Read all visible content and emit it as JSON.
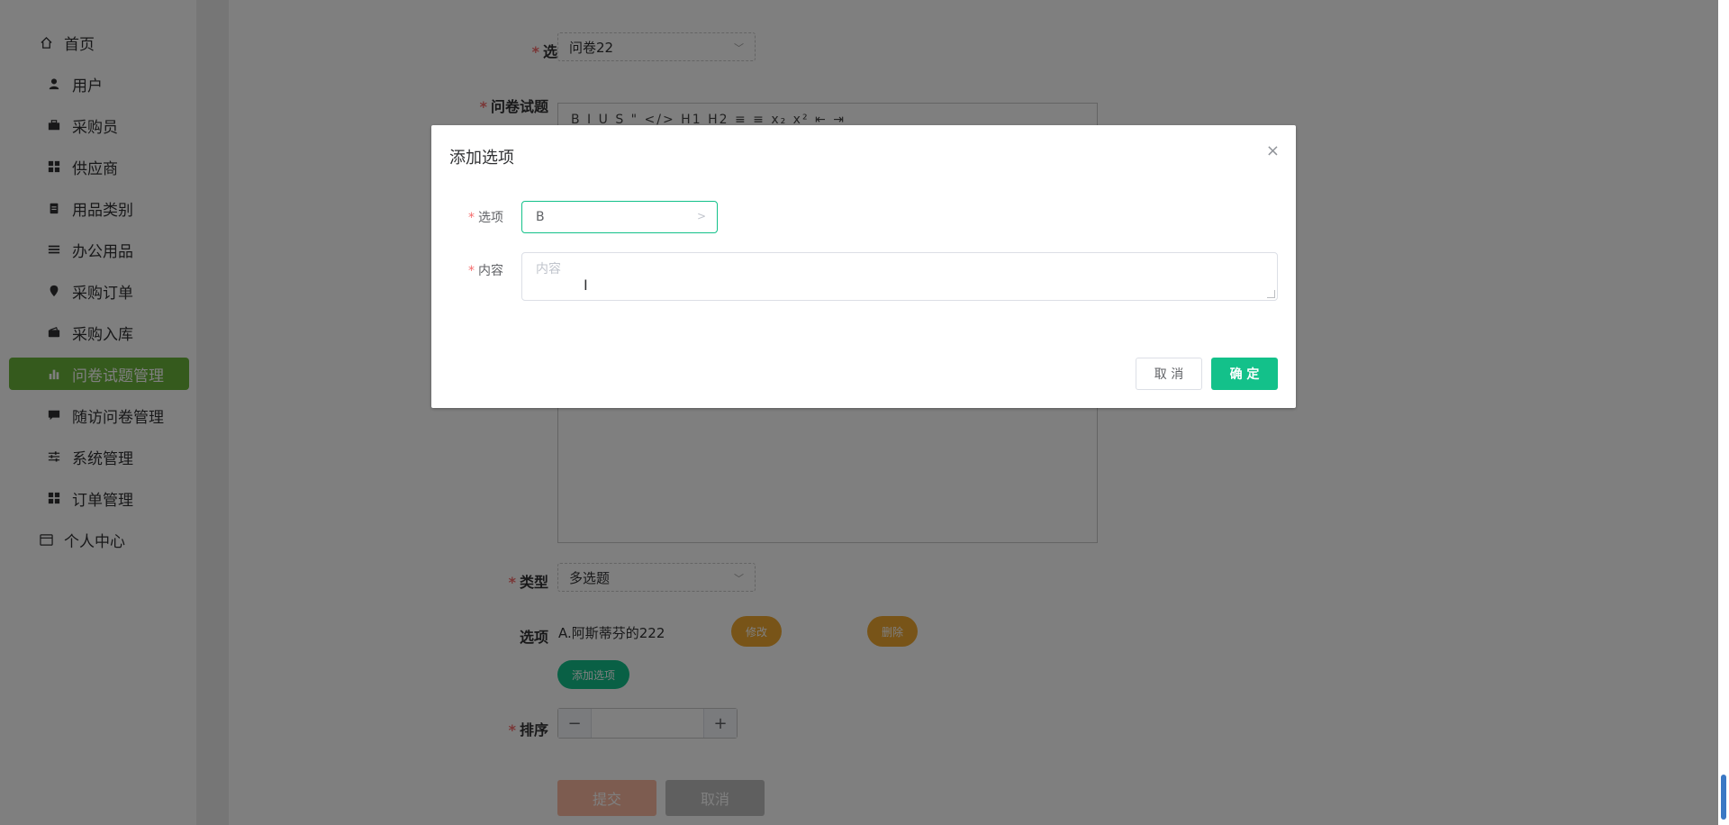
{
  "sidebar": {
    "items": [
      {
        "label": "首页",
        "icon": "home-icon"
      },
      {
        "label": "用户",
        "icon": "user-icon"
      },
      {
        "label": "采购员",
        "icon": "briefcase-icon"
      },
      {
        "label": "供应商",
        "icon": "grid-icon"
      },
      {
        "label": "用品类别",
        "icon": "clipboard-icon"
      },
      {
        "label": "办公用品",
        "icon": "list-icon"
      },
      {
        "label": "采购订单",
        "icon": "pin-icon"
      },
      {
        "label": "采购入库",
        "icon": "wallet-icon"
      },
      {
        "label": "问卷试题管理",
        "icon": "bar-chart-icon"
      },
      {
        "label": "随访问卷管理",
        "icon": "chat-icon"
      },
      {
        "label": "系统管理",
        "icon": "sliders-icon"
      },
      {
        "label": "订单管理",
        "icon": "grid-icon"
      },
      {
        "label": "个人中心",
        "icon": "card-icon"
      }
    ],
    "active_index": 8,
    "active_color": "#6bb53a"
  },
  "form": {
    "questionnaire_label": "选择随访问卷",
    "questionnaire_value": "问卷22",
    "question_label": "问卷试题",
    "editor_toolbar": "B I U S \" </> H1 H2 ≡ ≡ x₂ x² ⇤ ⇥",
    "type_label": "类型",
    "type_value": "多选题",
    "options_label": "选项",
    "existing_option": "A.阿斯蒂芬的222",
    "edit_button": "修改",
    "delete_button": "删除",
    "add_option_button": "添加选项",
    "sort_label": "排序",
    "sort_minus": "−",
    "sort_plus": "+",
    "sort_value": "",
    "submit_button": "提交",
    "cancel_button": "取消"
  },
  "dialog": {
    "title": "添加选项",
    "close_icon": "×",
    "option_label": "选项",
    "option_value": "B",
    "option_arrow": ">",
    "content_label": "内容",
    "content_placeholder": "内容",
    "cancel_button": "取 消",
    "confirm_button": "确 定",
    "confirm_color": "#13c18a"
  },
  "cursor_glyph": "I"
}
